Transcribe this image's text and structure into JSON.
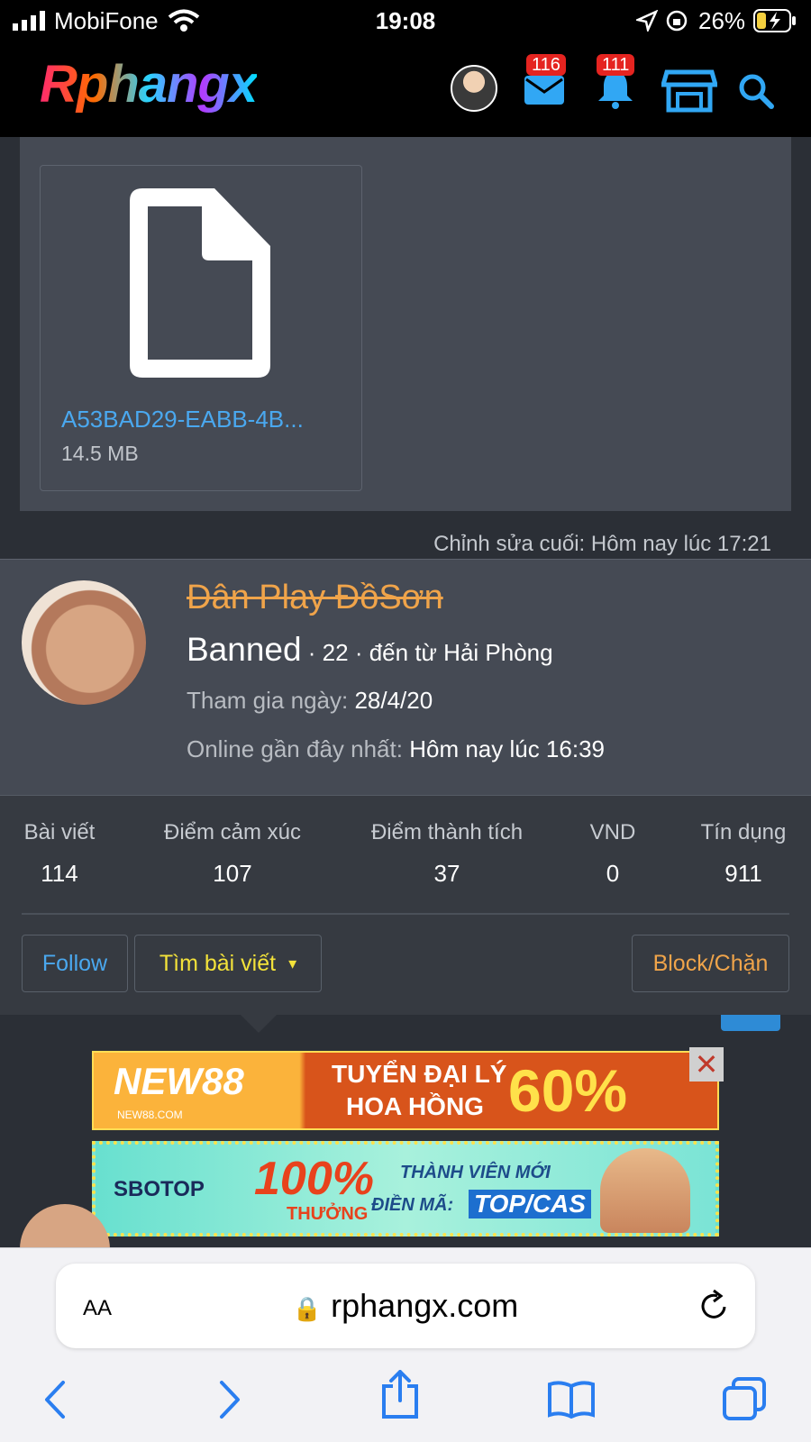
{
  "status_bar": {
    "carrier": "MobiFone",
    "time": "19:08",
    "battery_percent": "26%"
  },
  "header": {
    "logo_text": "Rphangx",
    "messages_badge": "116",
    "alerts_badge": "111"
  },
  "attachment": {
    "file_name": "A53BAD29-EABB-4B...",
    "file_size": "14.5 MB",
    "last_edit": "Chỉnh sửa cuối: Hôm nay lúc 17:21"
  },
  "user_card": {
    "name": "Dân Play ĐồSơn",
    "title": "Banned",
    "meta": " · 22 · đến từ Hải Phòng",
    "joined_label": "Tham gia ngày:",
    "joined_value": "28/4/20",
    "online_label": "Online gần đây nhất:",
    "online_value": "Hôm nay lúc 16:39"
  },
  "stats": [
    {
      "label": "Bài viết",
      "value": "114"
    },
    {
      "label": "Điểm cảm xúc",
      "value": "107"
    },
    {
      "label": "Điểm thành tích",
      "value": "37"
    },
    {
      "label": "VND",
      "value": "0"
    },
    {
      "label": "Tín dụng",
      "value": "911"
    }
  ],
  "buttons": {
    "follow": "Follow",
    "find_posts": "Tìm bài viết",
    "block": "Block/Chặn"
  },
  "ads": {
    "ad1_brand": "NEW88",
    "ad1_sub": "NEW88.COM",
    "ad1_line1": "TUYỂN ĐẠI LÝ",
    "ad1_line2": "HOA HỒNG",
    "ad1_pct": "60%",
    "ad2_brand": "SBOTOP",
    "ad2_pct": "100%",
    "ad2_bonus": "THƯỞNG",
    "ad2_line1": "THÀNH VIÊN MỚI",
    "ad2_line2": "ĐIỀN MÃ:",
    "ad2_code": "TOP/CAS"
  },
  "safari": {
    "text_size": "AA",
    "url": "rphangx.com"
  },
  "colors": {
    "accent_blue": "#4aa8ef",
    "accent_orange": "#f0a44a",
    "find_yellow": "#f3e23a",
    "badge_red": "#e52420"
  }
}
